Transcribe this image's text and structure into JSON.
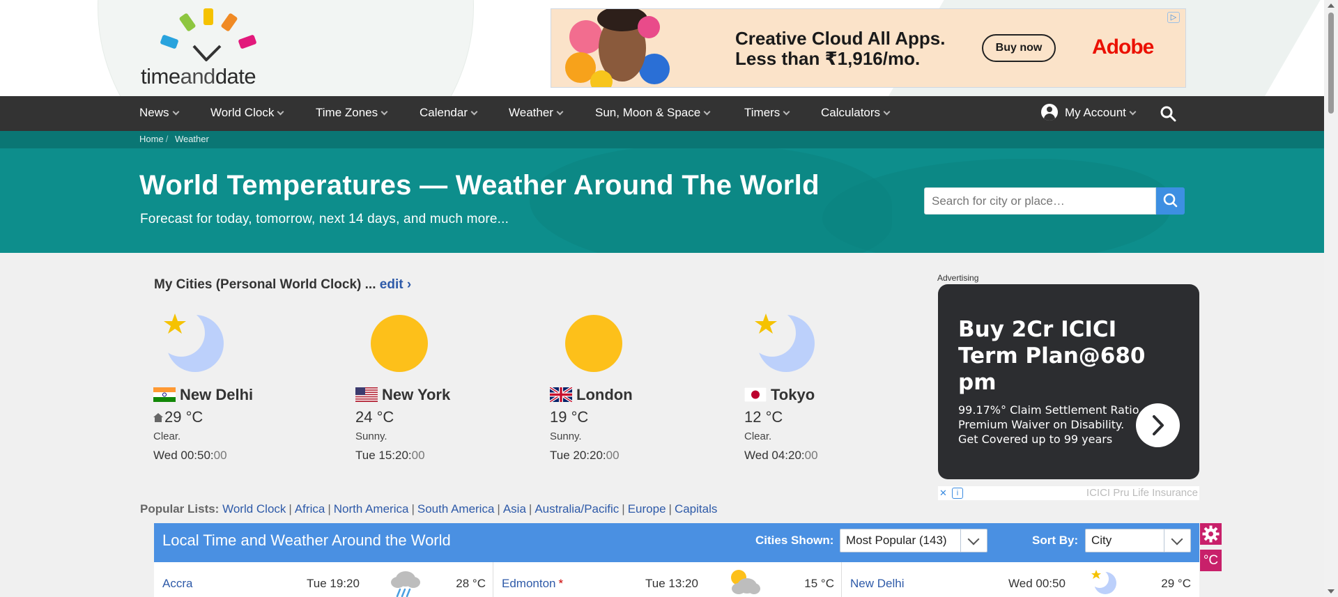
{
  "logo": {
    "part1": "time",
    "part2": "and",
    "part3": "date"
  },
  "top_ad": {
    "headline_line1": "Creative Cloud All Apps.",
    "headline_line2": "Less than ₹1,916/mo.",
    "cta": "Buy now",
    "brand": "Adobe",
    "adchoices": "▷",
    "brand_color": "#eb1000"
  },
  "nav": {
    "items": [
      {
        "label": "News"
      },
      {
        "label": "World Clock"
      },
      {
        "label": "Time Zones"
      },
      {
        "label": "Calendar"
      },
      {
        "label": "Weather"
      },
      {
        "label": "Sun, Moon & Space"
      },
      {
        "label": "Timers"
      },
      {
        "label": "Calculators"
      }
    ],
    "account": "My Account",
    "bg_color": "#333333"
  },
  "breadcrumb": {
    "home": "Home",
    "current": "Weather",
    "separator": "/"
  },
  "banner": {
    "title": "World Temperatures — Weather Around The World",
    "subtitle": "Forecast for today, tomorrow, next 14 days, and much more...",
    "search_placeholder": "Search for city or place…",
    "bg_color": "#0d8e8c"
  },
  "my_cities": {
    "title": "My Cities (Personal World Clock) ... ",
    "edit": "edit ›",
    "cities": [
      {
        "name": "New Delhi",
        "flag": "flag-india-icon",
        "temp": "29 °C",
        "condition": "Clear.",
        "time_main": "Wed 00:50:",
        "time_sec": "00",
        "icon": "moon-star-icon",
        "home": true
      },
      {
        "name": "New York",
        "flag": "flag-usa-icon",
        "temp": "24 °C",
        "condition": "Sunny.",
        "time_main": "Tue 15:20:",
        "time_sec": "00",
        "icon": "sun-icon"
      },
      {
        "name": "London",
        "flag": "flag-uk-icon",
        "temp": "19 °C",
        "condition": "Sunny.",
        "time_main": "Tue 20:20:",
        "time_sec": "00",
        "icon": "sun-icon"
      },
      {
        "name": "Tokyo",
        "flag": "flag-japan-icon",
        "temp": "12 °C",
        "condition": "Clear.",
        "time_main": "Wed 04:20:",
        "time_sec": "00",
        "icon": "moon-star-icon"
      }
    ]
  },
  "side_ad": {
    "label": "Advertising",
    "headline": "Buy 2Cr ICICI Term Plan@680 pm",
    "line1": "99.17%° Claim Settlement Ratio.",
    "line2": "Premium Waiver on Disability.",
    "line3": "Get Covered up to 99 years",
    "brand": "ICICI Pru Life Insurance",
    "close": "✕",
    "info": "i"
  },
  "popular": {
    "label": "Popular Lists:",
    "links": [
      "World Clock",
      "Africa",
      "North America",
      "South America",
      "Asia",
      "Australia/Pacific",
      "Europe",
      "Capitals"
    ]
  },
  "table": {
    "title": "Local Time and Weather Around the World",
    "cities_shown_label": "Cities Shown:",
    "cities_shown_value": "Most Popular (143)",
    "sort_by_label": "Sort By:",
    "sort_by_value": "City",
    "unit": "°C",
    "header_color": "#4a90e2",
    "rows": [
      {
        "city": "Accra",
        "dst": "",
        "time": "Tue 19:20",
        "icon": "rain-cloud-icon",
        "temp": "28 °C"
      },
      {
        "city": "Edmonton",
        "dst": "*",
        "time": "Tue 13:20",
        "icon": "partly-cloudy-icon",
        "temp": "15 °C"
      },
      {
        "city": "New Delhi",
        "dst": "",
        "time": "Wed 00:50",
        "icon": "moon-star-icon",
        "temp": "29 °C"
      }
    ]
  }
}
